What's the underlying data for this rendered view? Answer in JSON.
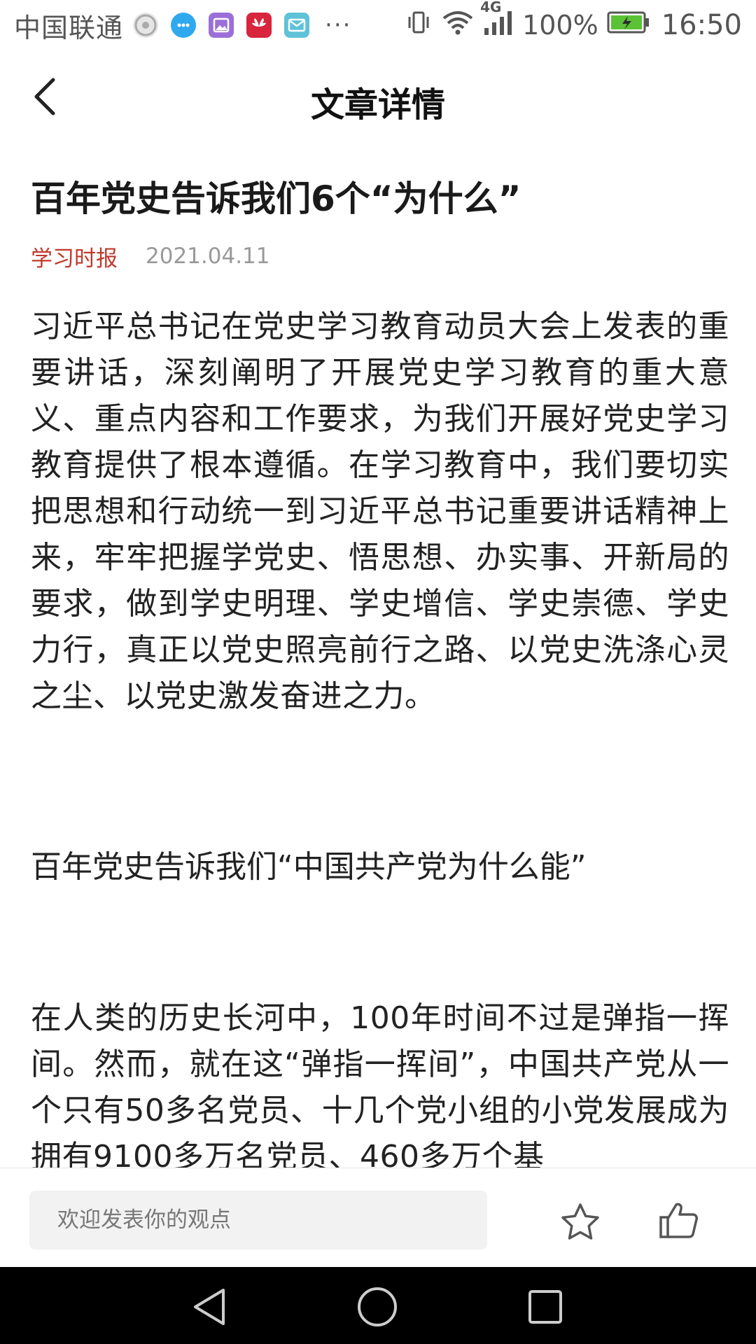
{
  "status_bar": {
    "carrier": "中国联通",
    "more_indicator": "···",
    "network_type": "4G",
    "battery": "100%",
    "time": "16:50",
    "notification_icons": [
      {
        "name": "wechat-moments-icon",
        "color": "#bdbdbd"
      },
      {
        "name": "message-bubble-icon",
        "color": "#2fa8f0"
      },
      {
        "name": "gallery-icon",
        "color": "#9b6fd8"
      },
      {
        "name": "huawei-icon",
        "color": "#d8243c"
      },
      {
        "name": "mail-icon",
        "color": "#5ec2d8"
      }
    ]
  },
  "nav": {
    "title": "文章详情"
  },
  "article": {
    "title": "百年党史告诉我们6个“为什么”",
    "source": "学习时报",
    "date": "2021.04.11",
    "paragraph_1": "习近平总书记在党史学习教育动员大会上发表的重要讲话，深刻阐明了开展党史学习教育的重大意义、重点内容和工作要求，为我们开展好党史学习教育提供了根本遵循。在学习教育中，我们要切实把思想和行动统一到习近平总书记重要讲话精神上来，牢牢把握学党史、悟思想、办实事、开新局的要求，做到学史明理、学史增信、学史崇德、学史力行，真正以党史照亮前行之路、以党史洗涤心灵之尘、以党史激发奋进之力。",
    "subheading": "百年党史告诉我们“中国共产党为什么能”",
    "paragraph_2": "在人类的历史长河中，100年时间不过是弹指一挥间。然而，就在这“弹指一挥间”，中国共产党从一个只有50多名党员、十几个党小组的小党发展成为拥有9100多万名党员、460多万个基"
  },
  "comment_bar": {
    "placeholder": "欢迎发表你的观点"
  },
  "colors": {
    "source_red": "#c0392b",
    "battery_green": "#5bc236"
  }
}
